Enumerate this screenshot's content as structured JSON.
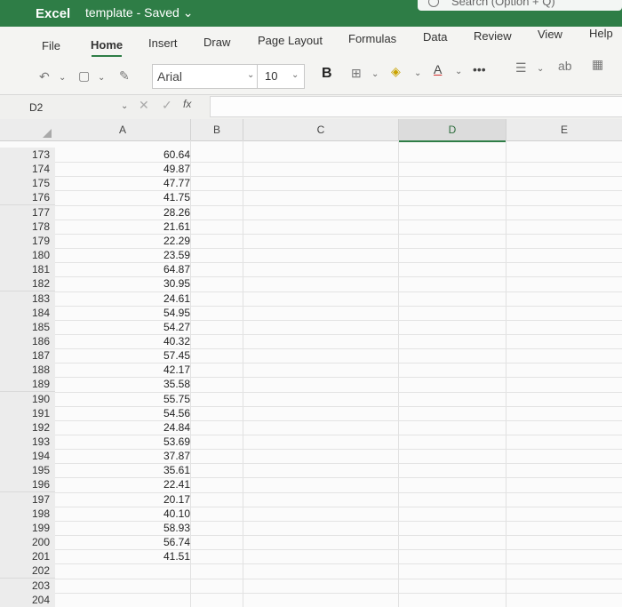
{
  "titlebar": {
    "app_name": "Excel",
    "doc_title": "template - Saved ⌄",
    "search_placeholder": "Search (Option + Q)"
  },
  "tabs": [
    "File",
    "Home",
    "Insert",
    "Draw",
    "Page Layout",
    "Formulas",
    "Data",
    "Review",
    "View",
    "Help"
  ],
  "active_tab": "Home",
  "toolbar": {
    "font": "Arial",
    "font_size": "10",
    "bold": "B",
    "more": "•••",
    "font_color_label": "A"
  },
  "formula_bar": {
    "name_box": "D2",
    "fx": "fx",
    "content": ""
  },
  "columns": [
    "A",
    "B",
    "C",
    "D",
    "E"
  ],
  "selected_column": "D",
  "rows": [
    {
      "n": "173",
      "a": "60.64"
    },
    {
      "n": "174",
      "a": "49.87"
    },
    {
      "n": "175",
      "a": "47.77"
    },
    {
      "n": "176",
      "a": "41.75"
    },
    {
      "n": "177",
      "a": "28.26"
    },
    {
      "n": "178",
      "a": "21.61"
    },
    {
      "n": "179",
      "a": "22.29"
    },
    {
      "n": "180",
      "a": "23.59"
    },
    {
      "n": "181",
      "a": "64.87"
    },
    {
      "n": "182",
      "a": "30.95"
    },
    {
      "n": "183",
      "a": "24.61"
    },
    {
      "n": "184",
      "a": "54.95"
    },
    {
      "n": "185",
      "a": "54.27"
    },
    {
      "n": "186",
      "a": "40.32"
    },
    {
      "n": "187",
      "a": "57.45"
    },
    {
      "n": "188",
      "a": "42.17"
    },
    {
      "n": "189",
      "a": "35.58"
    },
    {
      "n": "190",
      "a": "55.75"
    },
    {
      "n": "191",
      "a": "54.56"
    },
    {
      "n": "192",
      "a": "24.84"
    },
    {
      "n": "193",
      "a": "53.69"
    },
    {
      "n": "194",
      "a": "37.87"
    },
    {
      "n": "195",
      "a": "35.61"
    },
    {
      "n": "196",
      "a": "22.41"
    },
    {
      "n": "197",
      "a": "20.17"
    },
    {
      "n": "198",
      "a": "40.10"
    },
    {
      "n": "199",
      "a": "58.93"
    },
    {
      "n": "200",
      "a": "56.74"
    },
    {
      "n": "201",
      "a": "41.51"
    },
    {
      "n": "202",
      "a": ""
    },
    {
      "n": "203",
      "a": ""
    },
    {
      "n": "204",
      "a": ""
    }
  ],
  "colors": {
    "brand": "#2e7d46",
    "grid_bg": "#fbfbfb",
    "header_bg": "#ececec"
  }
}
